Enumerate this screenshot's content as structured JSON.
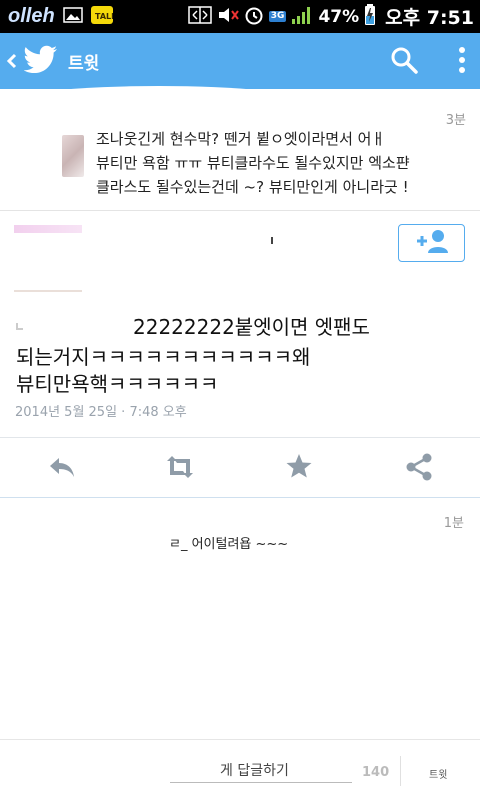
{
  "status_bar": {
    "carrier": "olleh",
    "network": "3G",
    "battery_percent": "47%",
    "time": "오후 7:51"
  },
  "app_bar": {
    "back_icon": "back-chevron",
    "logo": "twitter-bird-logo",
    "title": "트윗",
    "search_icon": "search-icon",
    "menu_icon": "overflow-menu-icon"
  },
  "in_reply_to": {
    "age": "3분",
    "text_lines": [
      "조나웃긴게 현수막? 뗀거 뷭ㅇ엣이라면서 어ㅐ",
      "뷰티만 욕함 ㅠㅠ 뷰티클라수도 될수있지만 엑소퍈",
      "클라스도 될수있는건데 ~? 뷰티만인게 아니라긋 !"
    ]
  },
  "follow_button": {
    "icon": "add-user-icon"
  },
  "tweet": {
    "lines": [
      "22222222붙엣이면 엣팬도",
      "되는거지ㅋㅋㅋㅋㅋㅋㅋㅋㅋㅋㅋ왜",
      "뷰티만욕핵ㅋㅋㅋㅋㅋㅋ"
    ],
    "date": "2014년 5월 25일 · 7:48 오후"
  },
  "actions": [
    "reply-icon",
    "retweet-icon",
    "favorite-icon",
    "share-icon"
  ],
  "reply": {
    "age": "1분",
    "text": "ㄹ_ 어이털려욥 ~~~"
  },
  "composer": {
    "placeholder": "게 답글하기",
    "char_count": "140",
    "tweet_button": "트윗"
  },
  "colors": {
    "brand": "#55acee",
    "status_bar": "#000000"
  }
}
